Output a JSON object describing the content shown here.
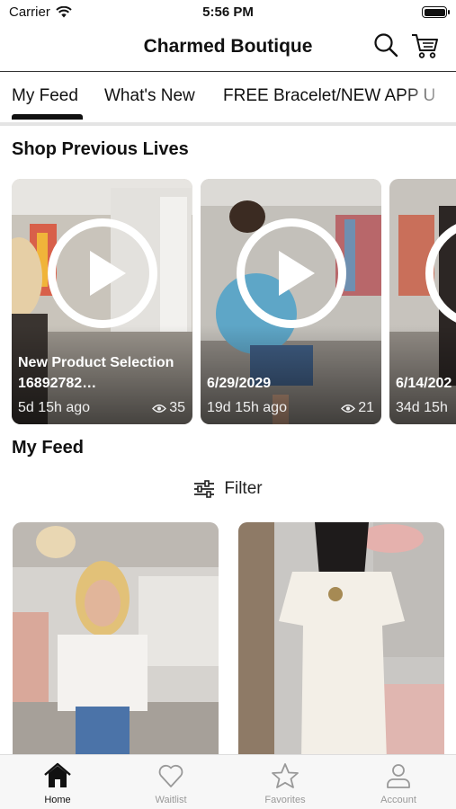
{
  "status": {
    "carrier": "Carrier",
    "time": "5:56 PM"
  },
  "header": {
    "title": "Charmed Boutique"
  },
  "tabs": [
    {
      "label": "My Feed"
    },
    {
      "label": "What's New"
    },
    {
      "label": "FREE Bracelet/NEW APP U"
    }
  ],
  "sections": {
    "lives_title": "Shop Previous Lives",
    "feed_title": "My Feed"
  },
  "lives": [
    {
      "title": "New Product Selection 16892782…",
      "ago": "5d 15h ago",
      "views": "35"
    },
    {
      "title": "6/29/2029",
      "ago": "19d 15h ago",
      "views": "21"
    },
    {
      "title": "6/14/202",
      "ago": "34d 15h",
      "views": ""
    }
  ],
  "filter": {
    "label": "Filter"
  },
  "bottom_nav": [
    {
      "label": "Home",
      "icon": "home-icon"
    },
    {
      "label": "Waitlist",
      "icon": "heart-icon"
    },
    {
      "label": "Favorites",
      "icon": "star-icon"
    },
    {
      "label": "Account",
      "icon": "account-icon"
    }
  ]
}
